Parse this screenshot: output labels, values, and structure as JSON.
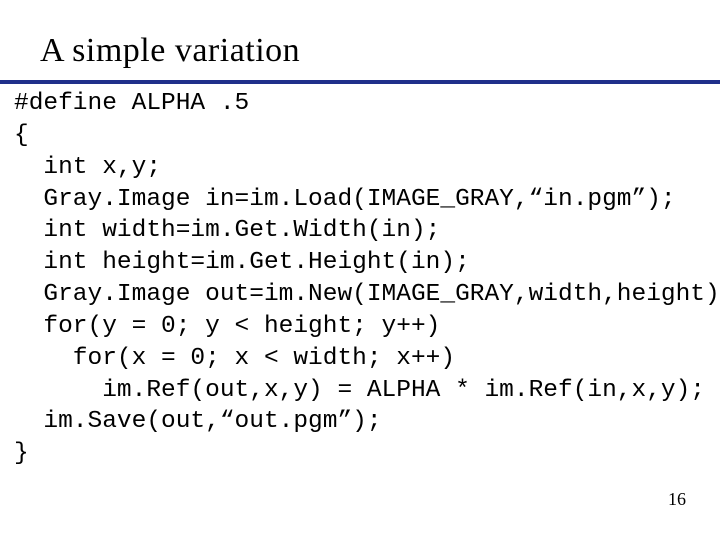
{
  "title": "A simple variation",
  "page_number": "16",
  "code": {
    "l01": "#define ALPHA .5",
    "l02": "{",
    "l03": "  int x,y;",
    "l04": "  Gray.Image in=im.Load(IMAGE_GRAY,“in.pgm”);",
    "l05": "  int width=im.Get.Width(in);",
    "l06": "  int height=im.Get.Height(in);",
    "l07": "  Gray.Image out=im.New(IMAGE_GRAY,width,height);",
    "l08": "  for(y = 0; y < height; y++)",
    "l09": "    for(x = 0; x < width; x++)",
    "l10": "      im.Ref(out,x,y) = ALPHA * im.Ref(in,x,y);",
    "l11": "  im.Save(out,“out.pgm”);",
    "l12": "}"
  }
}
